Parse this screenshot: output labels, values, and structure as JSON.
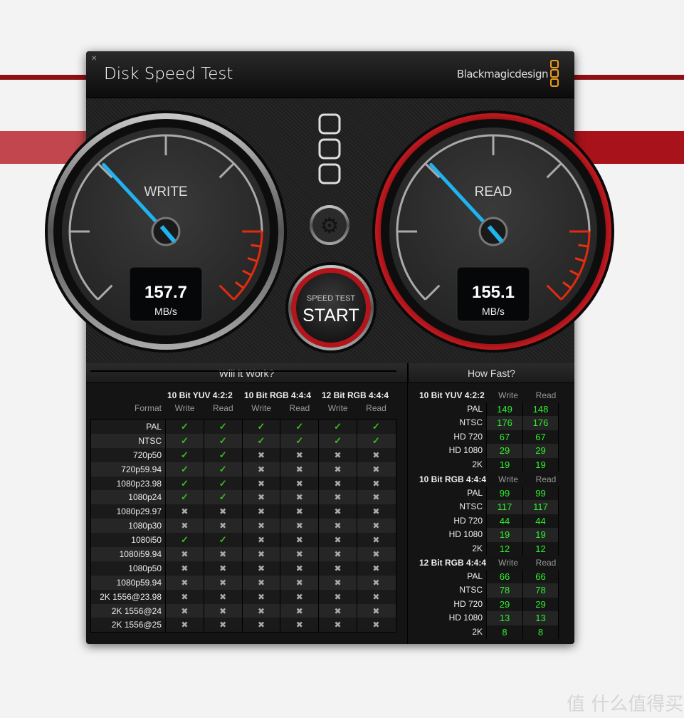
{
  "window": {
    "title": "Disk Speed Test",
    "brand": "Blackmagicdesign",
    "close_icon": "close-icon",
    "brand_color": "#f29a1d"
  },
  "write_gauge": {
    "label": "WRITE",
    "value": "157.7",
    "unit": "MB/s",
    "needle_color": "#1fb4f0"
  },
  "read_gauge": {
    "label": "READ",
    "value": "155.1",
    "unit": "MB/s",
    "needle_color": "#1fb4f0",
    "ring_color": "#b01218"
  },
  "start_button": {
    "top_label": "SPEED TEST",
    "label": "START"
  },
  "settings_button": {
    "icon": "gear-icon"
  },
  "will_it_work": {
    "title": "Will it Work?",
    "format_label": "Format",
    "groups": [
      "10 Bit YUV 4:2:2",
      "10 Bit RGB 4:4:4",
      "12 Bit RGB 4:4:4"
    ],
    "subcols": [
      "Write",
      "Read",
      "Write",
      "Read",
      "Write",
      "Read"
    ],
    "rows": [
      {
        "format": "PAL",
        "results": [
          1,
          1,
          1,
          1,
          1,
          1
        ]
      },
      {
        "format": "NTSC",
        "results": [
          1,
          1,
          1,
          1,
          1,
          1
        ]
      },
      {
        "format": "720p50",
        "results": [
          1,
          1,
          0,
          0,
          0,
          0
        ]
      },
      {
        "format": "720p59.94",
        "results": [
          1,
          1,
          0,
          0,
          0,
          0
        ]
      },
      {
        "format": "1080p23.98",
        "results": [
          1,
          1,
          0,
          0,
          0,
          0
        ]
      },
      {
        "format": "1080p24",
        "results": [
          1,
          1,
          0,
          0,
          0,
          0
        ]
      },
      {
        "format": "1080p29.97",
        "results": [
          0,
          0,
          0,
          0,
          0,
          0
        ]
      },
      {
        "format": "1080p30",
        "results": [
          0,
          0,
          0,
          0,
          0,
          0
        ]
      },
      {
        "format": "1080i50",
        "results": [
          1,
          1,
          0,
          0,
          0,
          0
        ]
      },
      {
        "format": "1080i59.94",
        "results": [
          0,
          0,
          0,
          0,
          0,
          0
        ]
      },
      {
        "format": "1080p50",
        "results": [
          0,
          0,
          0,
          0,
          0,
          0
        ]
      },
      {
        "format": "1080p59.94",
        "results": [
          0,
          0,
          0,
          0,
          0,
          0
        ]
      },
      {
        "format": "2K 1556@23.98",
        "results": [
          0,
          0,
          0,
          0,
          0,
          0
        ]
      },
      {
        "format": "2K 1556@24",
        "results": [
          0,
          0,
          0,
          0,
          0,
          0
        ]
      },
      {
        "format": "2K 1556@25",
        "results": [
          0,
          0,
          0,
          0,
          0,
          0
        ]
      }
    ],
    "check_icon": "✓",
    "cross_icon": "✖",
    "check_color": "#3bbd1f"
  },
  "how_fast": {
    "title": "How Fast?",
    "write_label": "Write",
    "read_label": "Read",
    "value_color": "#2df02d",
    "groups": [
      {
        "name": "10 Bit YUV 4:2:2",
        "rows": [
          {
            "label": "PAL",
            "write": "149",
            "read": "148"
          },
          {
            "label": "NTSC",
            "write": "176",
            "read": "176"
          },
          {
            "label": "HD 720",
            "write": "67",
            "read": "67"
          },
          {
            "label": "HD 1080",
            "write": "29",
            "read": "29"
          },
          {
            "label": "2K",
            "write": "19",
            "read": "19"
          }
        ]
      },
      {
        "name": "10 Bit RGB 4:4:4",
        "rows": [
          {
            "label": "PAL",
            "write": "99",
            "read": "99"
          },
          {
            "label": "NTSC",
            "write": "117",
            "read": "117"
          },
          {
            "label": "HD 720",
            "write": "44",
            "read": "44"
          },
          {
            "label": "HD 1080",
            "write": "19",
            "read": "19"
          },
          {
            "label": "2K",
            "write": "12",
            "read": "12"
          }
        ]
      },
      {
        "name": "12 Bit RGB 4:4:4",
        "rows": [
          {
            "label": "PAL",
            "write": "66",
            "read": "66"
          },
          {
            "label": "NTSC",
            "write": "78",
            "read": "78"
          },
          {
            "label": "HD 720",
            "write": "29",
            "read": "29"
          },
          {
            "label": "HD 1080",
            "write": "13",
            "read": "13"
          },
          {
            "label": "2K",
            "write": "8",
            "read": "8"
          }
        ]
      }
    ]
  },
  "watermark": {
    "text": "值 什么值得买"
  }
}
